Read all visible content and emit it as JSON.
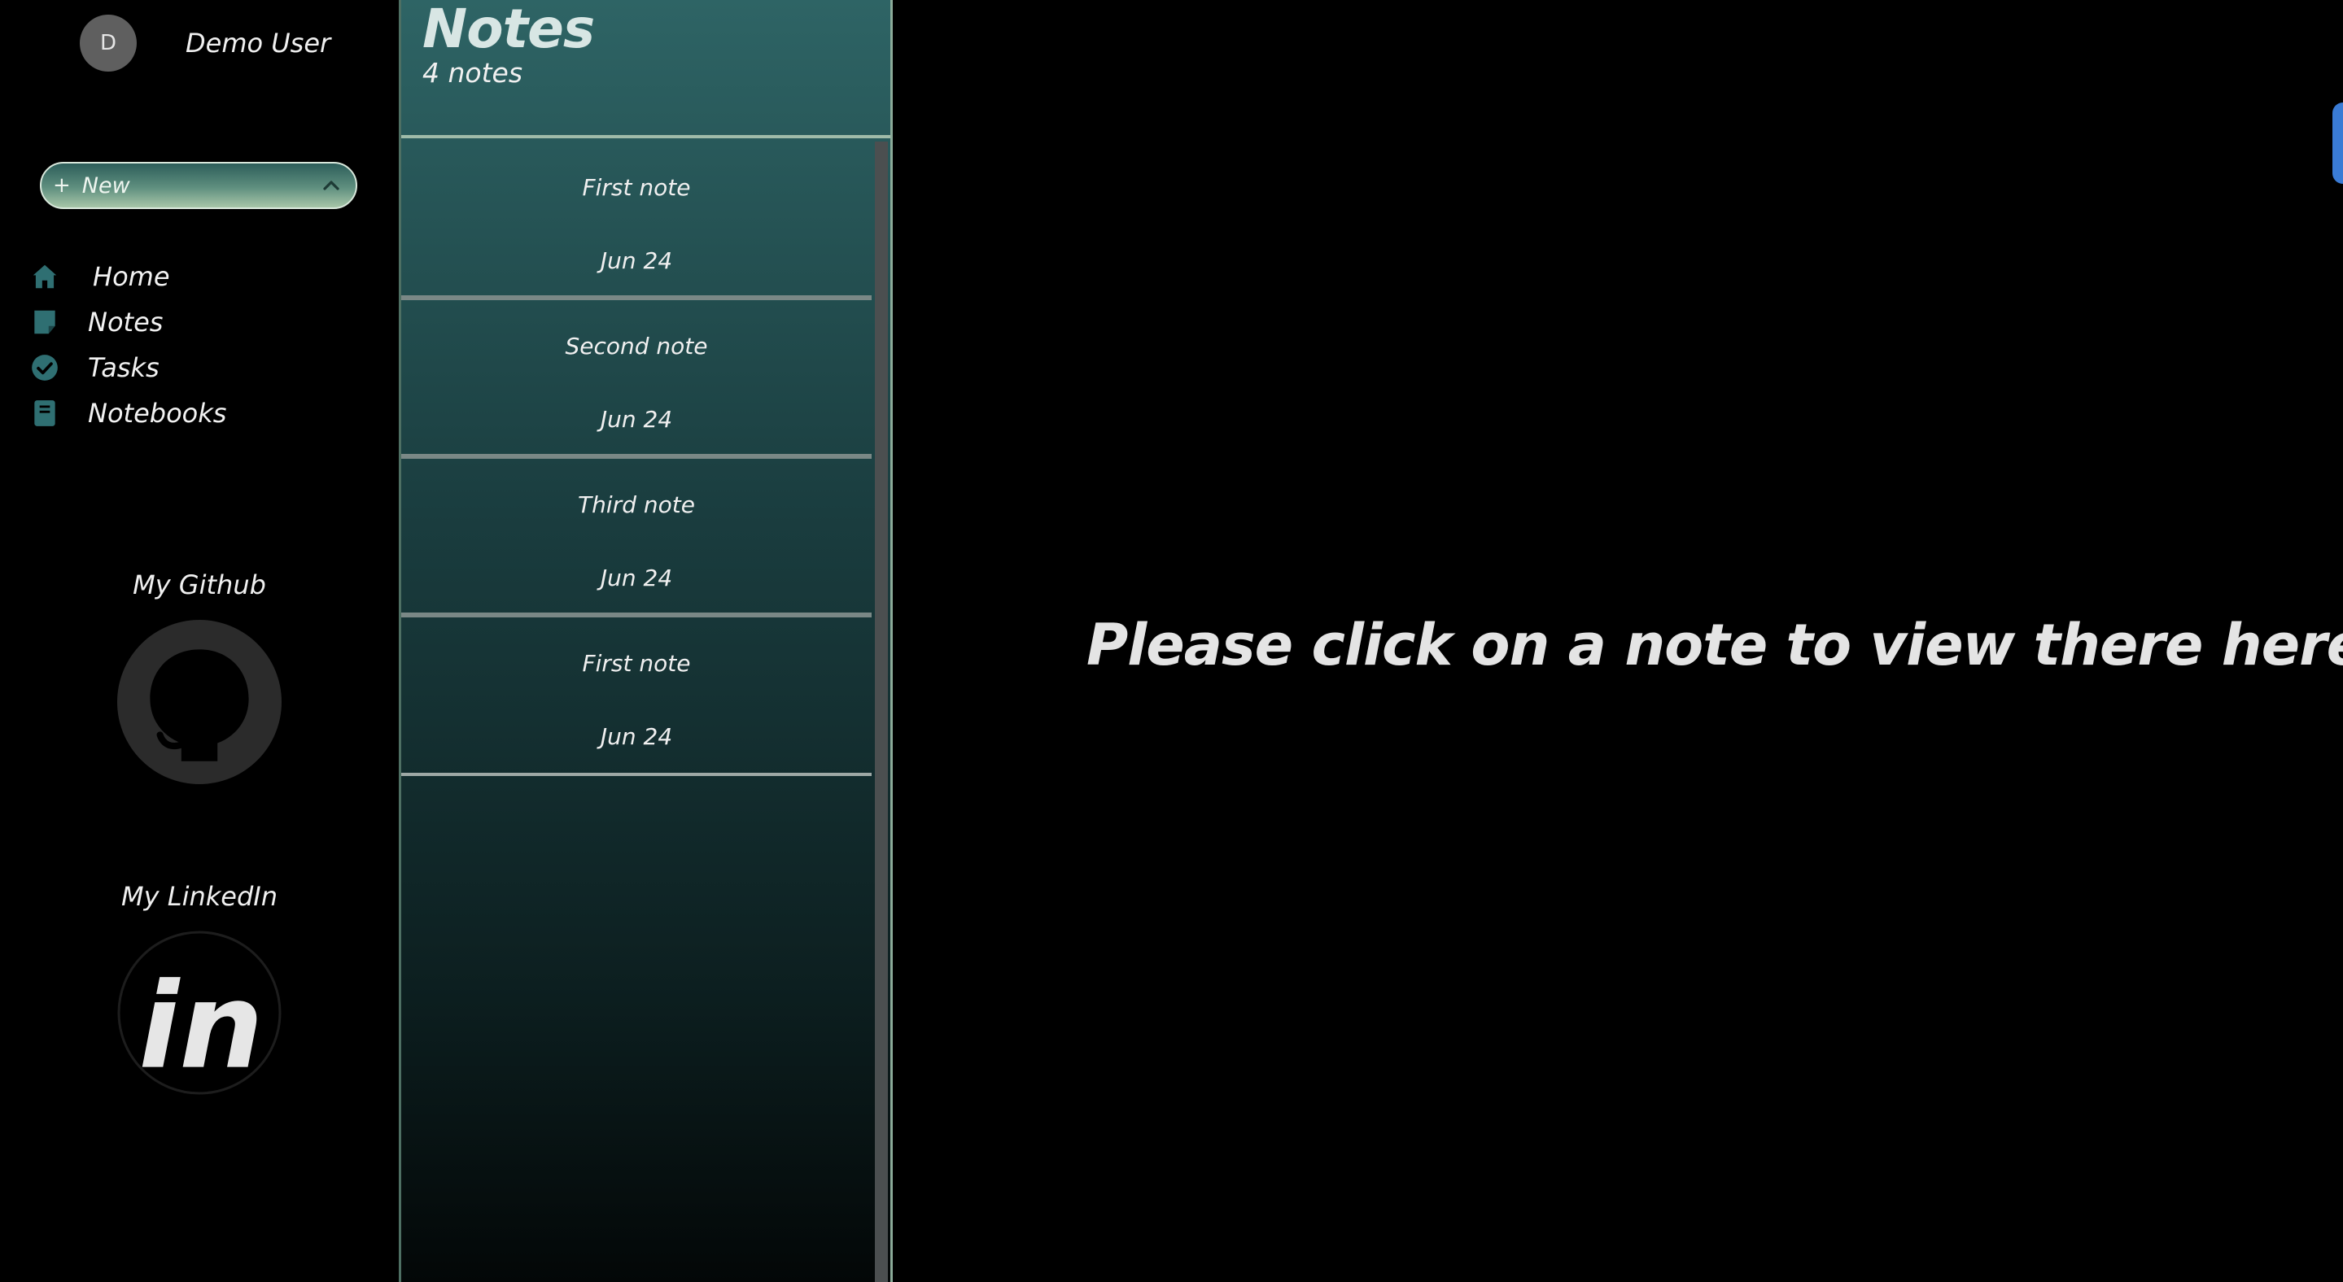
{
  "user": {
    "avatar_initial": "D",
    "name": "Demo User"
  },
  "new_button": {
    "plus": "+",
    "label": "New"
  },
  "nav": [
    {
      "label": "Home",
      "icon": "home-icon"
    },
    {
      "label": "Notes",
      "icon": "note-icon"
    },
    {
      "label": "Tasks",
      "icon": "check-circle-icon"
    },
    {
      "label": "Notebooks",
      "icon": "book-icon"
    }
  ],
  "social": {
    "github_title": "My Github",
    "linkedin_title": "My LinkedIn",
    "linkedin_glyph": "in"
  },
  "notes_panel": {
    "title": "Notes",
    "count": "4 notes",
    "items": [
      {
        "title": "First note",
        "date": "Jun 24"
      },
      {
        "title": "Second note",
        "date": "Jun 24"
      },
      {
        "title": "Third note",
        "date": "Jun 24"
      },
      {
        "title": "First note",
        "date": "Jun 24"
      }
    ]
  },
  "main": {
    "placeholder": "Please click on a note to view there here..."
  },
  "colors": {
    "accent_teal": "#2e6465",
    "icon_teal": "#2f6f72",
    "edge_tab_blue": "#3a7bd5"
  }
}
